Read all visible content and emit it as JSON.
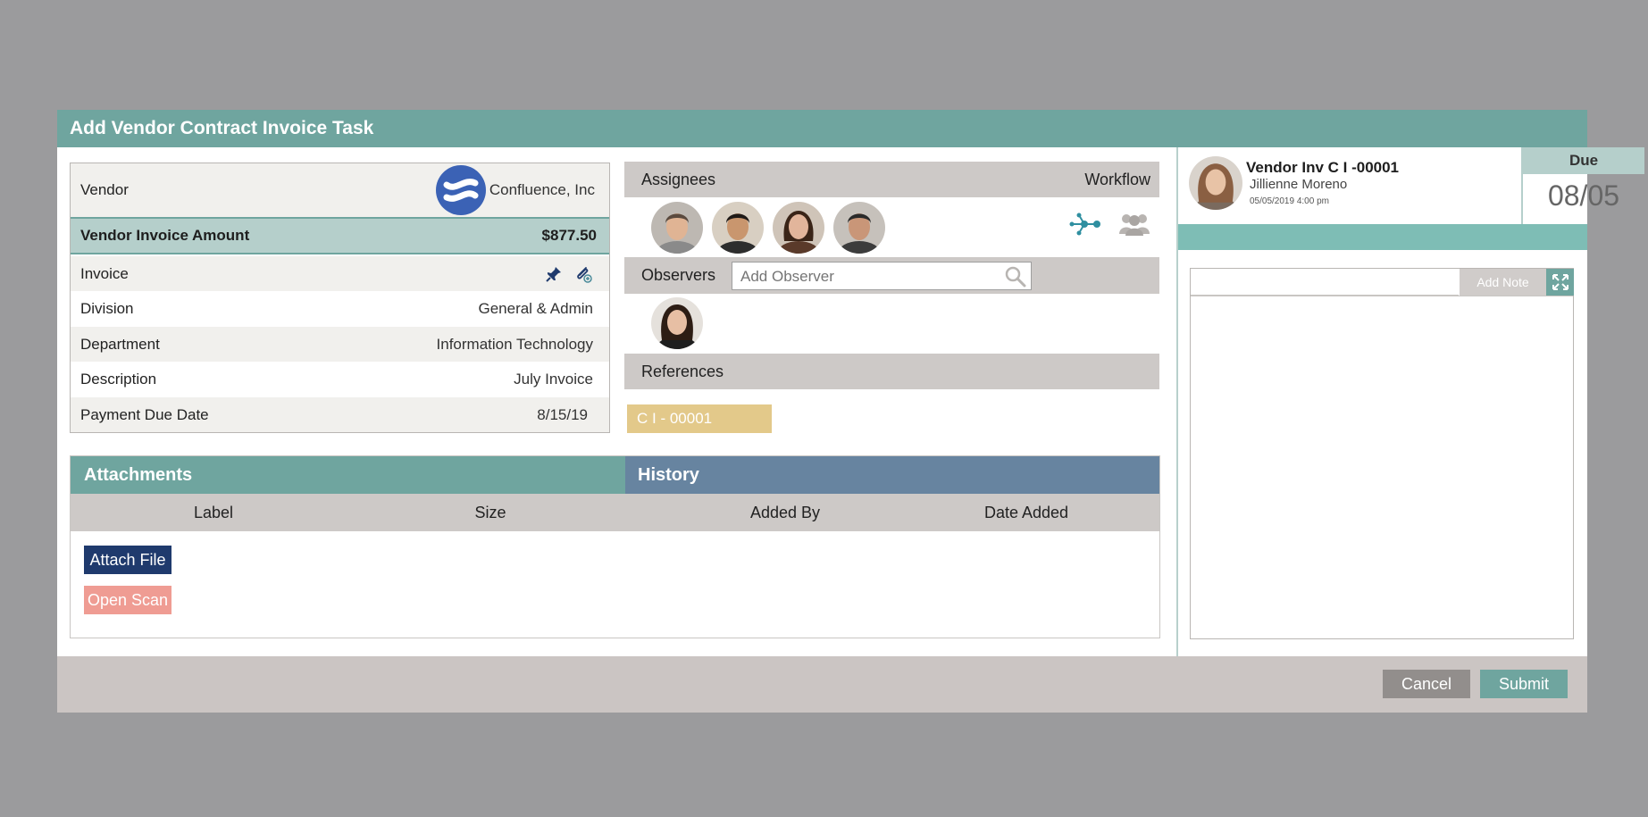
{
  "dialog": {
    "title": "Add Vendor Contract Invoice Task"
  },
  "vendor_panel": {
    "vendor_label": "Vendor",
    "vendor_name": "Confluence, Inc",
    "amount_label": "Vendor Invoice Amount",
    "amount_value": "$877.50",
    "rows": [
      {
        "label": "Invoice",
        "value": ""
      },
      {
        "label": "Division",
        "value": "General & Admin"
      },
      {
        "label": "Department",
        "value": "Information Technology"
      },
      {
        "label": "Description",
        "value": "July Invoice"
      },
      {
        "label": "Payment Due Date",
        "value": "8/15/19"
      }
    ]
  },
  "assignees": {
    "label": "Assignees",
    "workflow_label": "Workflow",
    "people": [
      {
        "name": "assignee-1",
        "skin": "#e0b494",
        "hair": "#5a4a3e",
        "shirt": "#8a8a8a",
        "bg": "#bdb8b2"
      },
      {
        "name": "assignee-2",
        "skin": "#c9966e",
        "hair": "#1f1a17",
        "shirt": "#2d2d2d",
        "bg": "#d8cfc2"
      },
      {
        "name": "assignee-3",
        "skin": "#e2b59b",
        "hair": "#3a2417",
        "shirt": "#5a3a2a",
        "bg": "#cfc4b8"
      },
      {
        "name": "assignee-4",
        "skin": "#c99678",
        "hair": "#2a2a2a",
        "shirt": "#3c3c3c",
        "bg": "#c6c1bb"
      }
    ]
  },
  "observers": {
    "label": "Observers",
    "placeholder": "Add Observer",
    "people": [
      {
        "name": "observer-1",
        "skin": "#e7bfa4",
        "hair": "#2d1d14",
        "shirt": "#1e1e1e",
        "bg": "#e5e1dc"
      }
    ]
  },
  "references": {
    "label": "References",
    "tags": [
      "C I - 00001"
    ]
  },
  "attachments": {
    "title": "Attachments",
    "columns": [
      "Label",
      "Size"
    ],
    "attach_button": "Attach File",
    "scan_button": "Open Scan"
  },
  "history": {
    "title": "History",
    "columns": [
      "Added By",
      "Date Added"
    ]
  },
  "task_card": {
    "title": "Vendor Inv C I -00001",
    "person": "Jillienne Moreno",
    "timestamp": "05/05/2019 4:00 pm",
    "due_label": "Due",
    "due_value": "08/05"
  },
  "notes": {
    "add_note_button": "Add Note",
    "input_value": ""
  },
  "footer": {
    "cancel_label": "Cancel",
    "submit_label": "Submit"
  },
  "colors": {
    "teal": "#6fa59f",
    "history_blue": "#6784a0",
    "attach_navy": "#1f3a6d",
    "scan_pink": "#ef9c93",
    "reference_gold": "#e3c98a",
    "vendor_logo_blue": "#3b62b5"
  }
}
